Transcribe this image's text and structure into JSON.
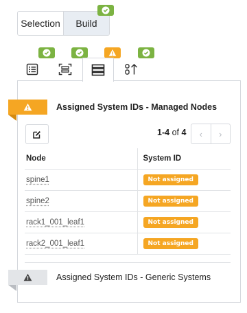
{
  "mode_switch": {
    "options": [
      "Selection",
      "Build"
    ],
    "active": "Build"
  },
  "tabs": [
    {
      "icon": "list-icon",
      "status": "ok"
    },
    {
      "icon": "scan-icon",
      "status": "ok"
    },
    {
      "icon": "server-stack-icon",
      "status": "warning",
      "active": true
    },
    {
      "icon": "sort-icon",
      "status": "ok"
    }
  ],
  "section_managed": {
    "title": "Assigned System IDs - Managed Nodes",
    "status": "warning"
  },
  "pager": {
    "range": "1-4",
    "of_label": "of",
    "total": "4"
  },
  "table": {
    "headers": [
      "Node",
      "System ID"
    ],
    "rows": [
      {
        "node": "spine1",
        "system_id": "Not assigned"
      },
      {
        "node": "spine2",
        "system_id": "Not assigned"
      },
      {
        "node": "rack1_001_leaf1",
        "system_id": "Not assigned"
      },
      {
        "node": "rack2_001_leaf1",
        "system_id": "Not assigned"
      }
    ]
  },
  "section_generic": {
    "title": "Assigned System IDs - Generic Systems",
    "status": "warning"
  },
  "colors": {
    "ok": "#7cb342",
    "warning": "#f5a623",
    "neutral": "#e3e5e8"
  }
}
